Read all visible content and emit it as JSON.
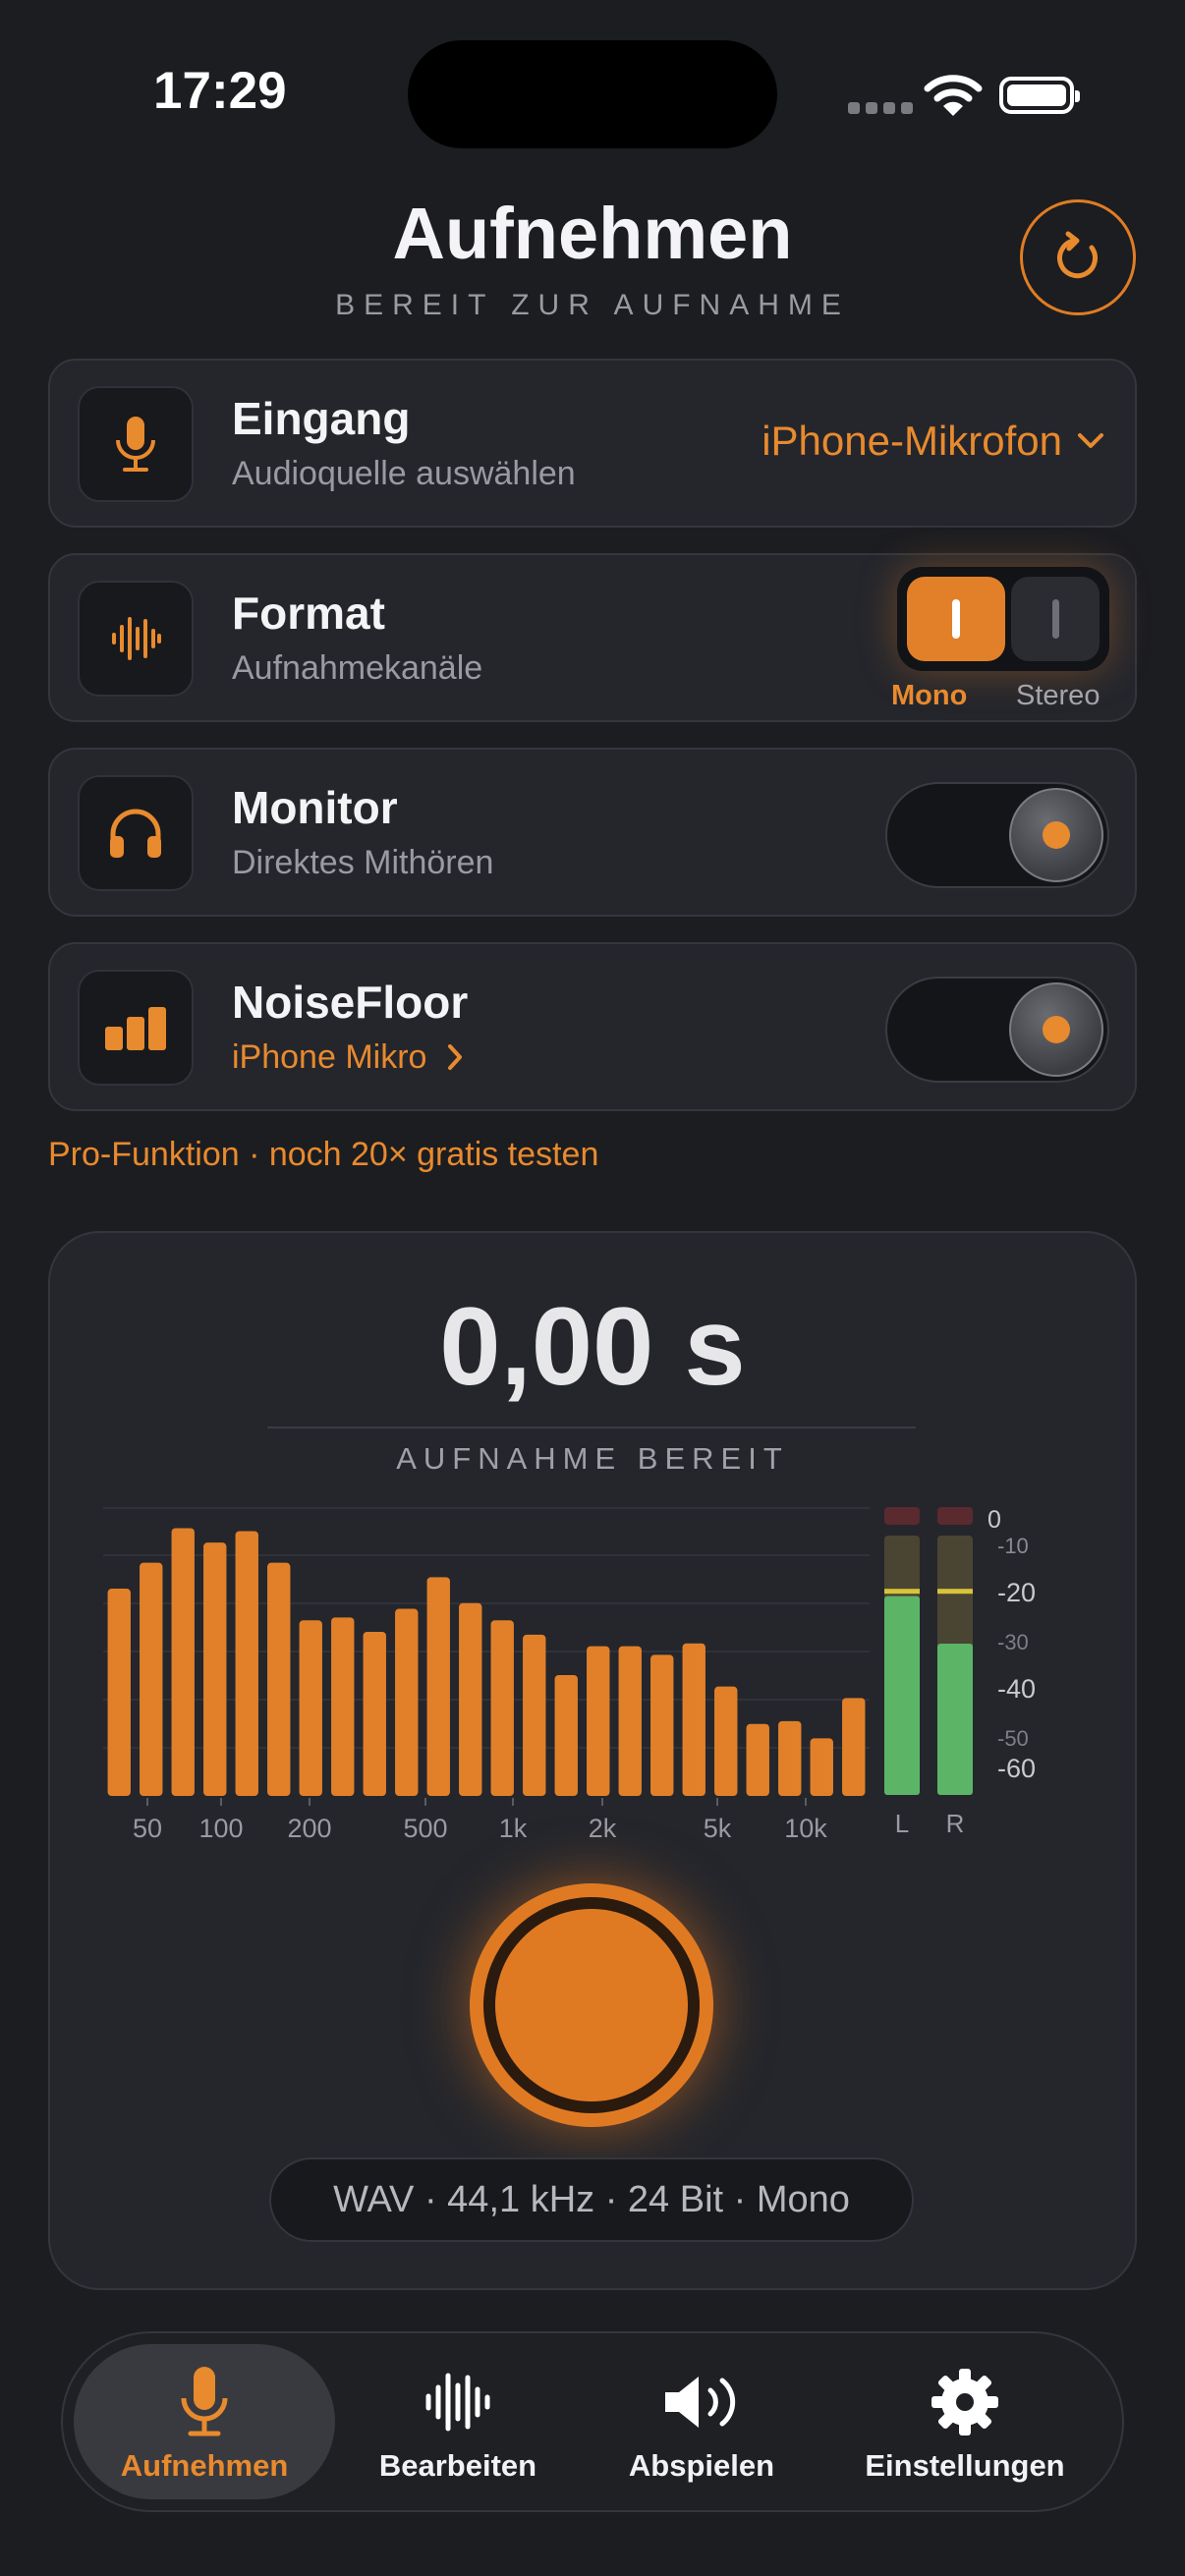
{
  "status": {
    "time": "17:29"
  },
  "header": {
    "title": "Aufnehmen",
    "subtitle": "BEREIT ZUR AUFNAHME",
    "refresh_icon": "refresh-icon"
  },
  "accent": "#E2802A",
  "cards": {
    "input": {
      "title": "Eingang",
      "subtitle": "Audioquelle auswählen",
      "value": "iPhone-Mikrofon",
      "icon": "microphone-icon"
    },
    "format": {
      "title": "Format",
      "subtitle": "Aufnahmekanäle",
      "options": [
        "Mono",
        "Stereo"
      ],
      "selected": "Mono",
      "icon": "waveform-icon"
    },
    "monitor": {
      "title": "Monitor",
      "subtitle": "Direktes Mithören",
      "enabled": true,
      "icon": "headphones-icon"
    },
    "noisefloor": {
      "title": "NoiseFloor",
      "subtitle": "iPhone Mikro",
      "enabled": true,
      "icon": "bars-icon"
    }
  },
  "pro_note": "Pro-Funktion · noch 20× gratis testen",
  "recorder": {
    "timer": "0,00 s",
    "state": "AUFNAHME BEREIT",
    "format_summary": "WAV · 44,1 kHz · 24 Bit · Mono"
  },
  "chart_data": {
    "type": "bar",
    "x_tick_labels": [
      "50",
      "100",
      "200",
      "500",
      "1k",
      "2k",
      "5k",
      "10k"
    ],
    "y_tick_labels": [
      "0",
      "-10",
      "-20",
      "-30",
      "-40",
      "-50",
      "-60"
    ],
    "ylim": [
      -60,
      0
    ],
    "bar_levels": [
      0.72,
      0.81,
      0.93,
      0.88,
      0.92,
      0.81,
      0.61,
      0.62,
      0.57,
      0.65,
      0.76,
      0.67,
      0.61,
      0.56,
      0.42,
      0.52,
      0.52,
      0.49,
      0.53,
      0.38,
      0.25,
      0.26,
      0.2,
      0.34
    ],
    "meters": [
      {
        "label": "L",
        "level_db": -14,
        "peak_db": -13
      },
      {
        "label": "R",
        "level_db": -25,
        "peak_db": -13
      }
    ]
  },
  "tabs": [
    {
      "label": "Aufnehmen",
      "icon": "microphone-icon",
      "active": true
    },
    {
      "label": "Bearbeiten",
      "icon": "waveform-icon",
      "active": false
    },
    {
      "label": "Abspielen",
      "icon": "speaker-icon",
      "active": false
    },
    {
      "label": "Einstellungen",
      "icon": "gear-icon",
      "active": false
    }
  ]
}
